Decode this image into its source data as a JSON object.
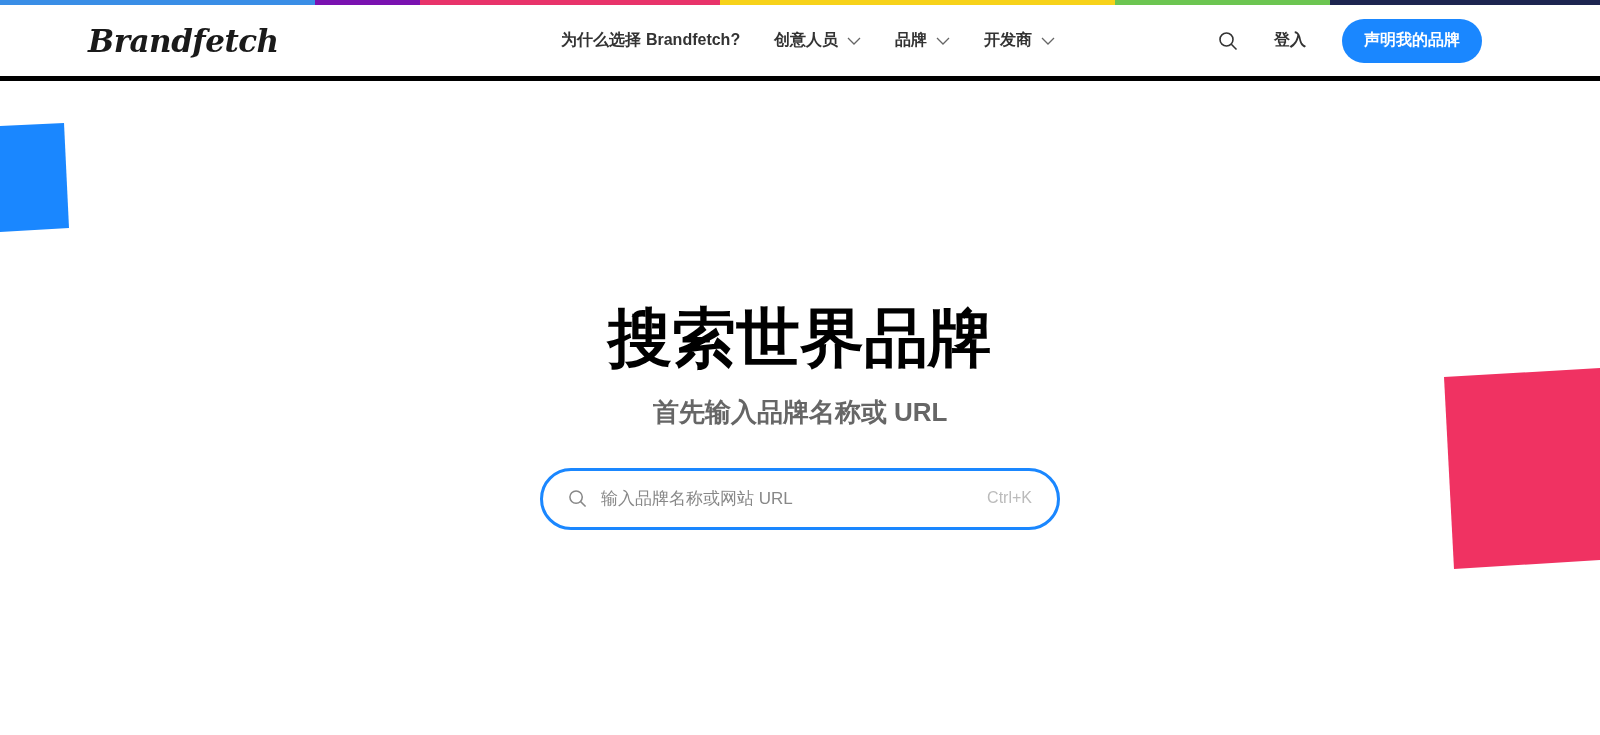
{
  "header": {
    "logo": "Brandfetch",
    "nav": [
      {
        "label": "为什么选择 Brandfetch?",
        "has_menu": false
      },
      {
        "label": "创意人员",
        "has_menu": true
      },
      {
        "label": "品牌",
        "has_menu": true
      },
      {
        "label": "开发商",
        "has_menu": true
      }
    ],
    "login": "登入",
    "cta": "声明我的品牌"
  },
  "hero": {
    "title": "搜索世界品牌",
    "subtitle": "首先输入品牌名称或 URL",
    "search": {
      "placeholder": "输入品牌名称或网站 URL",
      "shortcut": "Ctrl+K"
    }
  }
}
